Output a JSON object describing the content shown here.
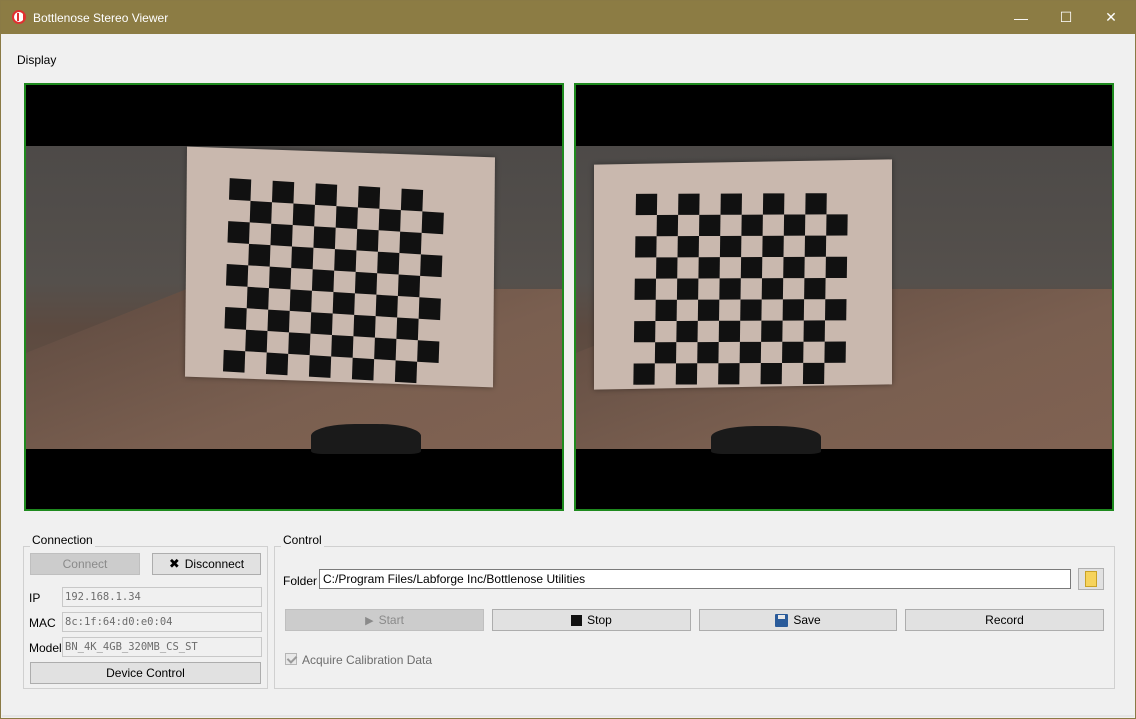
{
  "window": {
    "title": "Bottlenose Stereo Viewer",
    "controls": {
      "minimize": "—",
      "maximize": "☐",
      "close": "✕"
    }
  },
  "menu": {
    "display": "Display"
  },
  "connection": {
    "legend": "Connection",
    "connect_label": "Connect",
    "disconnect_label": "Disconnect",
    "ip_label": "IP",
    "ip_value": "192.168.1.34",
    "mac_label": "MAC",
    "mac_value": "8c:1f:64:d0:e0:04",
    "model_label": "Model",
    "model_value": "BN_4K_4GB_320MB_CS_ST",
    "device_control_label": "Device Control"
  },
  "control": {
    "legend": "Control",
    "folder_label": "Folder",
    "folder_value": "C:/Program Files/Labforge Inc/Bottlenose Utilities",
    "start_label": "Start",
    "stop_label": "Stop",
    "save_label": "Save",
    "record_label": "Record",
    "acquire_label": "Acquire Calibration Data",
    "acquire_checked": true
  },
  "colors": {
    "titlebar": "#8c7c44",
    "viewer_border": "#1e8a1e",
    "window_bg": "#f0f0f0"
  },
  "icons": {
    "app": "bottlenose-logo-icon",
    "disconnect": "x-icon",
    "start": "play-icon",
    "stop": "stop-icon",
    "save": "floppy-disk-icon",
    "folder": "folder-icon"
  }
}
